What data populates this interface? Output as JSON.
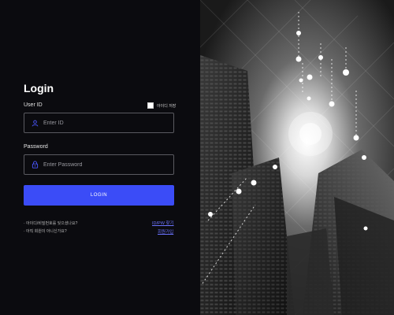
{
  "login": {
    "title": "Login",
    "user_id_label": "User ID",
    "remember_id_label": "아이디 저장",
    "id_placeholder": "Enter ID",
    "password_label": "Password",
    "password_placeholder": "Enter Password",
    "login_button": "LOGIN",
    "help_forgot": "· 아이디/비밀번호를 잊으셨나요?",
    "help_not_member": "· 아직 회원이 아니신가요?",
    "link_find": "ID/PW 찾기",
    "link_signup": "회원가입"
  },
  "colors": {
    "background": "#0b0b0f",
    "accent": "#3b4cf7",
    "link": "#6b73ff",
    "field_border": "#5a5a60"
  },
  "icons": {
    "user_field": "user-icon",
    "password_field": "lock-icon"
  }
}
